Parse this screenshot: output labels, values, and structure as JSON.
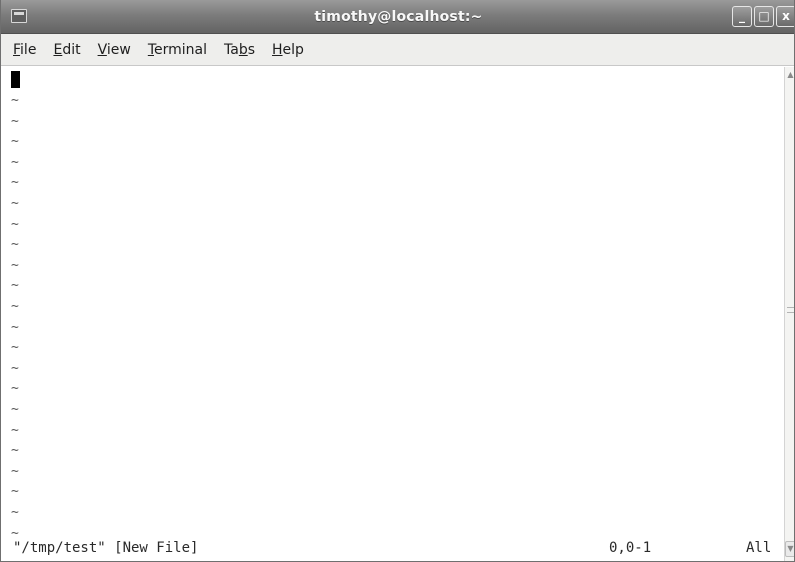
{
  "window": {
    "title": "timothy@localhost:~"
  },
  "wm_buttons": {
    "minimize": "_",
    "maximize": "□",
    "close": "x"
  },
  "menu": [
    {
      "label": "File",
      "mnemonic": "F",
      "rest": "ile",
      "pre": ""
    },
    {
      "label": "Edit",
      "mnemonic": "E",
      "rest": "dit",
      "pre": ""
    },
    {
      "label": "View",
      "mnemonic": "V",
      "rest": "iew",
      "pre": ""
    },
    {
      "label": "Terminal",
      "mnemonic": "T",
      "rest": "erminal",
      "pre": ""
    },
    {
      "label": "Tabs",
      "mnemonic": "b",
      "rest": "s",
      "pre": "Ta"
    },
    {
      "label": "Help",
      "mnemonic": "H",
      "rest": "elp",
      "pre": ""
    }
  ],
  "editor": {
    "empty_line_marker": "~",
    "empty_line_count": 22,
    "status": {
      "file": "\"/tmp/test\" [New File]",
      "position": "0,0-1",
      "scroll": "All"
    }
  },
  "scrollbar": {
    "up_arrow": "▲",
    "down_arrow": "▼"
  },
  "colors": {
    "titlebar": "#7c7c7c",
    "menubar": "#eeeeec",
    "terminal_bg": "#ffffff",
    "cursor": "#000000"
  }
}
